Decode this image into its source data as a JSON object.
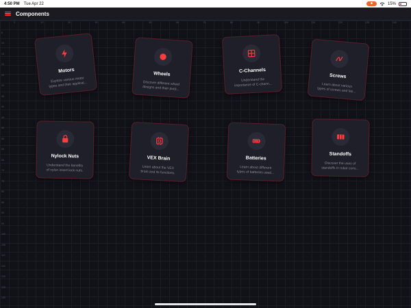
{
  "status": {
    "time": "4:50 PM",
    "date": "Tue Apr 22",
    "battery": "15%"
  },
  "header": {
    "title": "Components"
  },
  "cards": [
    {
      "title": "Motors",
      "desc1": "Explore various motor",
      "desc2": "types and their applicat...",
      "icon": "lightning-icon"
    },
    {
      "title": "Wheels",
      "desc1": "Discover different wheel",
      "desc2": "designs and their purp...",
      "icon": "circle-icon"
    },
    {
      "title": "C-Channels",
      "desc1": "Understand the",
      "desc2": "importance of C-chann...",
      "icon": "grid-icon"
    },
    {
      "title": "Screws",
      "desc1": "Learn about various",
      "desc2": "types of screws and fas...",
      "icon": "screw-icon"
    },
    {
      "title": "Nylock Nuts",
      "desc1": "Understand the benefits",
      "desc2": "of nylon insert lock nuts.",
      "icon": "lock-icon"
    },
    {
      "title": "VEX Brain",
      "desc1": "Learn about the VEX",
      "desc2": "brain and its functions.",
      "icon": "chip-icon"
    },
    {
      "title": "Batteries",
      "desc1": "Learn about different",
      "desc2": "types of batteries used...",
      "icon": "battery-icon"
    },
    {
      "title": "Standoffs",
      "desc1": "Discover the uses of",
      "desc2": "standoffs in robot cons...",
      "icon": "columns-icon"
    }
  ],
  "colors": {
    "accent": "#ff3b3b",
    "background": "#111118",
    "card": "#1f1f29",
    "card_border": "#5a1f27"
  }
}
